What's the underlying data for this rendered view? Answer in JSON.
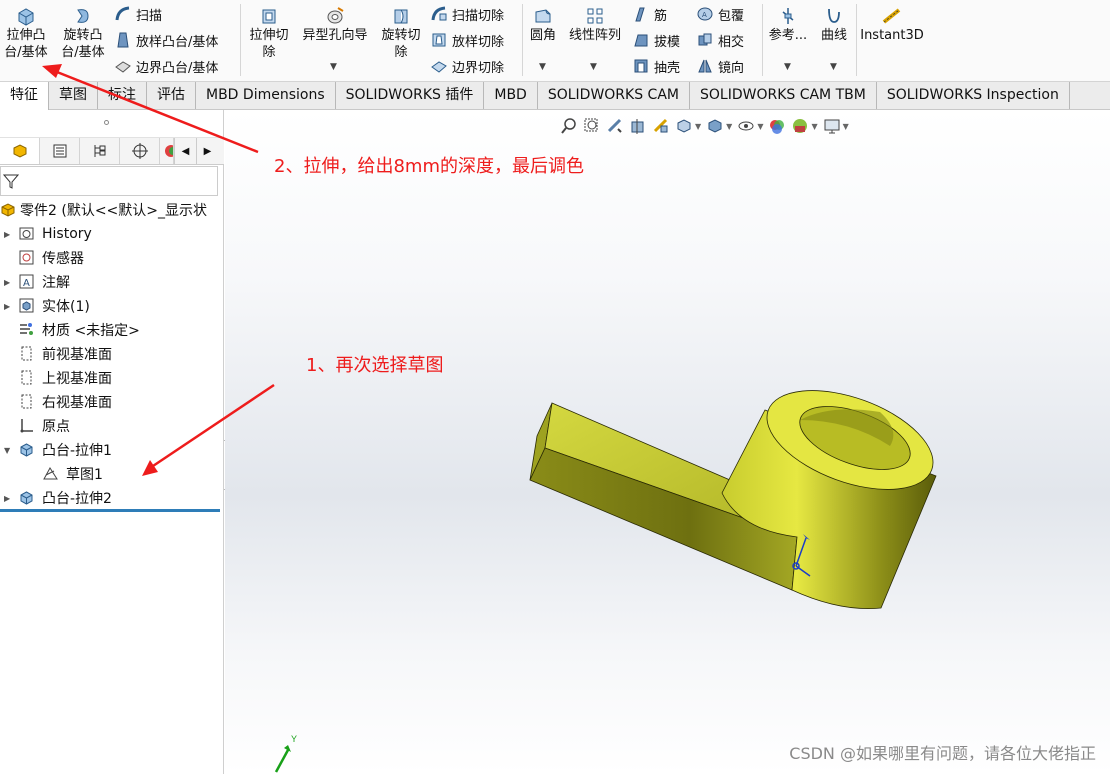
{
  "ribbon": {
    "extrude_boss": "拉伸凸\n台/基体",
    "revolve_boss": "旋转凸\n台/基体",
    "sweep": "扫描",
    "loft_boss": "放样凸台/基体",
    "boundary_boss": "边界凸台/基体",
    "extrude_cut": "拉伸切\n除",
    "hole_wizard": "异型孔向导",
    "revolve_cut": "旋转切\n除",
    "sweep_cut": "扫描切除",
    "loft_cut": "放样切除",
    "boundary_cut": "边界切除",
    "fillet": "圆角",
    "linear_pattern": "线性阵列",
    "rib": "筋",
    "draft": "拔模",
    "shell": "抽壳",
    "wrap": "包覆",
    "intersect": "相交",
    "mirror": "镜向",
    "reference": "参考...",
    "curves": "曲线",
    "instant3d": "Instant3D"
  },
  "tabs": [
    {
      "label": "特征",
      "active": true
    },
    {
      "label": "草图"
    },
    {
      "label": "标注"
    },
    {
      "label": "评估"
    },
    {
      "label": "MBD Dimensions"
    },
    {
      "label": "SOLIDWORKS 插件"
    },
    {
      "label": "MBD"
    },
    {
      "label": "SOLIDWORKS CAM"
    },
    {
      "label": "SOLIDWORKS CAM TBM"
    },
    {
      "label": "SOLIDWORKS Inspection"
    }
  ],
  "tree": {
    "root": "零件2 (默认<<默认>_显示状",
    "items": [
      {
        "label": "History",
        "icon": "history-folder-icon"
      },
      {
        "label": "传感器",
        "icon": "sensor-icon"
      },
      {
        "label": "注解",
        "icon": "annotation-icon"
      },
      {
        "label": "实体(1)",
        "icon": "solid-bodies-icon"
      },
      {
        "label": "材质 <未指定>",
        "icon": "material-icon"
      },
      {
        "label": "前视基准面",
        "icon": "plane-icon"
      },
      {
        "label": "上视基准面",
        "icon": "plane-icon"
      },
      {
        "label": "右视基准面",
        "icon": "plane-icon"
      },
      {
        "label": "原点",
        "icon": "origin-icon"
      },
      {
        "label": "凸台-拉伸1",
        "icon": "extrude-feature-icon"
      },
      {
        "label": "草图1",
        "icon": "sketch-icon"
      },
      {
        "label": "凸台-拉伸2",
        "icon": "extrude-feature-icon"
      }
    ]
  },
  "annotations": {
    "step2": "2、拉伸，给出8mm的深度，最后调色",
    "step1": "1、再次选择草图"
  },
  "triad": {
    "y_label": "Y"
  },
  "watermark": "CSDN @如果哪里有问题，请各位大佬指正",
  "colors": {
    "model": "#d8db3a",
    "annotation_red": "#ee1c1c",
    "tree_end_bar": "#2e7db8"
  }
}
